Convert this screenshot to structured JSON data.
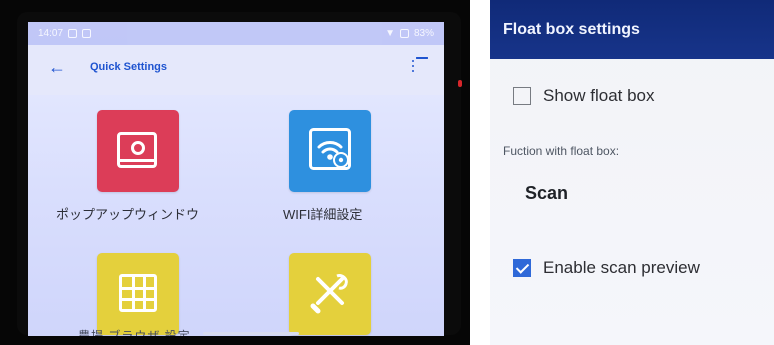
{
  "left_device": {
    "status_bar": {
      "time": "14:07",
      "left_icons": [
        "notification-icon",
        "signal-icon"
      ],
      "right_text": "83%",
      "right_icons": [
        "wifi-icon",
        "battery-icon"
      ]
    },
    "app_title": "Quick Settings",
    "back_icon": "←",
    "menu_icon": "list-icon",
    "tiles": [
      {
        "label": "ポップアップウィンドウ",
        "icon": "popup-window-icon",
        "color": "#dc3d58"
      },
      {
        "label": "WIFI詳細設定",
        "icon": "wifi-settings-icon",
        "color": "#2e90df"
      },
      {
        "label": "",
        "icon": "grid-icon",
        "color": "#e4d03c"
      },
      {
        "label": "",
        "icon": "tools-icon",
        "color": "#e4d03c"
      }
    ],
    "partial_bottom_text": "農場 ブラウザ 設定"
  },
  "right_settings": {
    "title": "Float box settings",
    "show_float_box": {
      "label": "Show float box",
      "checked": false
    },
    "function_label": "Fuction with float box:",
    "function_value": "Scan",
    "enable_scan_preview": {
      "label": "Enable scan preview",
      "checked": true
    }
  },
  "colors": {
    "accent_blue": "#1f54d0",
    "header_navy": "#102a78",
    "tile_red": "#dc3d58",
    "tile_blue": "#2e90df",
    "tile_yellow": "#e4d03c",
    "checkbox_blue": "#2f69d8"
  }
}
